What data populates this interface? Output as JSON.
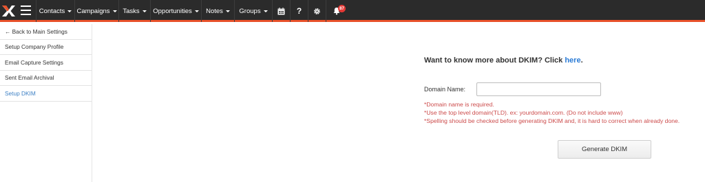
{
  "topbar": {
    "nav": [
      {
        "label": "Contacts"
      },
      {
        "label": "Campaigns"
      },
      {
        "label": "Tasks"
      },
      {
        "label": "Opportunities"
      },
      {
        "label": "Notes"
      },
      {
        "label": "Groups"
      }
    ],
    "help_label": "?",
    "notification_count": "87",
    "accent_color": "#e8512a"
  },
  "sidebar": {
    "back_label": "← Back to Main Settings",
    "items": [
      {
        "label": "Setup Company Profile"
      },
      {
        "label": "Email Capture Settings"
      },
      {
        "label": "Sent Email Archival"
      },
      {
        "label": "Setup DKIM"
      }
    ]
  },
  "main": {
    "title_prefix": "Want to know more about DKIM? Click ",
    "title_link": "here",
    "title_suffix": ".",
    "domain_label": "Domain Name:",
    "domain_value": "",
    "errors": [
      "*Domain name is required.",
      "*Use the top level domain(TLD). ex: yourdomain.com. (Do not include www)",
      "*Spelling should be checked before generating DKIM and, it is hard to correct when already done."
    ],
    "generate_label": "Generate DKIM"
  }
}
